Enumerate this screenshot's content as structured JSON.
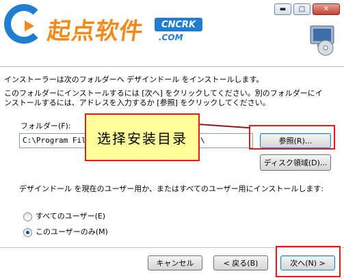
{
  "window": {
    "minimize_glyph": "▬",
    "maximize_glyph": "□",
    "close_glyph": "✕"
  },
  "banner": {
    "logo_text": "起点软件",
    "logo_badge": "CNCRK",
    "logo_sub": ".COM",
    "accent": "#f08a18",
    "brand_blue": "#1f7ed0"
  },
  "body": {
    "intro": "インストーラーは次のフォルダーへ デザインドール をインストールします。",
    "instructions": "このフォルダーにインストールするには [次へ] をクリックしてください。別のフォルダーにインストールするには、アドレスを入力するか [参照] をクリックしてください。"
  },
  "folder": {
    "label": "フォルダー(F):",
    "value": "C:\\Program Files\\",
    "value_tail": "\\",
    "browse_label": "参照(R)...",
    "disk_label": "ディスク領域(D)..."
  },
  "install_for": {
    "question": "デザインドール を現在のユーザー用か、またはすべてのユーザー用にインストールします:",
    "options": [
      {
        "label": "すべてのユーザー(E)",
        "checked": false
      },
      {
        "label": "このユーザーのみ(M)",
        "checked": true
      }
    ]
  },
  "footer": {
    "cancel_label": "キャンセル",
    "back_label": "< 戻る(B)",
    "next_label": "次へ(N) >"
  },
  "annotation": {
    "callout_text": "选择安装目录",
    "highlight_color": "#e81b1b"
  }
}
